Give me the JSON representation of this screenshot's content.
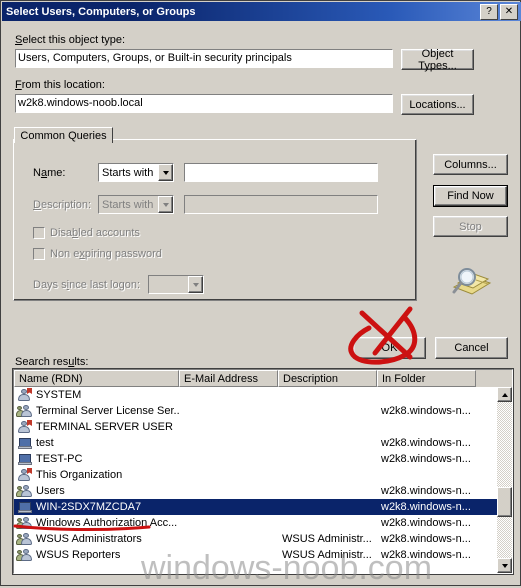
{
  "window": {
    "title": "Select Users, Computers, or Groups",
    "help_button": "?",
    "close_button": "✕"
  },
  "object_type": {
    "label": "Select this object type:",
    "value": "Users, Computers, Groups, or Built-in security principals",
    "button": "Object Types..."
  },
  "location": {
    "label": "From this location:",
    "value": "w2k8.windows-noob.local",
    "button": "Locations..."
  },
  "tab": {
    "label": "Common Queries"
  },
  "query": {
    "name_label": "Name:",
    "name_condition": "Starts with",
    "name_value": "",
    "description_label": "Description:",
    "description_condition": "Starts with",
    "description_value": "",
    "disabled_accounts": "Disabled accounts",
    "non_expiring_password": "Non expiring password",
    "days_since_logon_label": "Days since last logon:",
    "days_since_logon_value": ""
  },
  "side_buttons": {
    "columns": "Columns...",
    "find_now": "Find Now",
    "stop": "Stop"
  },
  "footer_buttons": {
    "ok": "OK",
    "cancel": "Cancel"
  },
  "results": {
    "label": "Search results:",
    "columns": [
      "Name (RDN)",
      "E-Mail Address",
      "Description",
      "In Folder"
    ],
    "rows": [
      {
        "name": "SYSTEM",
        "email": "",
        "description": "",
        "folder": "",
        "icon": "builtin-principal-icon",
        "selected": false
      },
      {
        "name": "Terminal Server License Ser...",
        "email": "",
        "description": "",
        "folder": "w2k8.windows-n...",
        "icon": "group-icon",
        "selected": false
      },
      {
        "name": "TERMINAL SERVER USER",
        "email": "",
        "description": "",
        "folder": "",
        "icon": "builtin-principal-icon",
        "selected": false
      },
      {
        "name": "test",
        "email": "",
        "description": "",
        "folder": "w2k8.windows-n...",
        "icon": "computer-icon",
        "selected": false
      },
      {
        "name": "TEST-PC",
        "email": "",
        "description": "",
        "folder": "w2k8.windows-n...",
        "icon": "computer-icon",
        "selected": false
      },
      {
        "name": "This Organization",
        "email": "",
        "description": "",
        "folder": "",
        "icon": "builtin-principal-icon",
        "selected": false
      },
      {
        "name": "Users",
        "email": "",
        "description": "",
        "folder": "w2k8.windows-n...",
        "icon": "group-icon",
        "selected": false
      },
      {
        "name": "WIN-2SDX7MZCDA7",
        "email": "",
        "description": "",
        "folder": "w2k8.windows-n...",
        "icon": "computer-icon",
        "selected": true
      },
      {
        "name": "Windows Authorization Acc...",
        "email": "",
        "description": "",
        "folder": "w2k8.windows-n...",
        "icon": "group-icon",
        "selected": false
      },
      {
        "name": "WSUS Administrators",
        "email": "",
        "description": "WSUS Administr...",
        "folder": "w2k8.windows-n...",
        "icon": "group-icon",
        "selected": false
      },
      {
        "name": "WSUS Reporters",
        "email": "",
        "description": "WSUS Administr...",
        "folder": "w2k8.windows-n...",
        "icon": "group-icon",
        "selected": false
      }
    ]
  },
  "annotations": {
    "ok_marked": true,
    "selected_row_underlined": true,
    "color": "#cc1111"
  },
  "watermark": {
    "text": "windows-noob.com"
  },
  "colors": {
    "title_start": "#0a246a",
    "title_end": "#5b86d8",
    "dialog_face": "#d4d0c8",
    "selection": "#0a246a",
    "annotation_red": "#cc1111"
  }
}
